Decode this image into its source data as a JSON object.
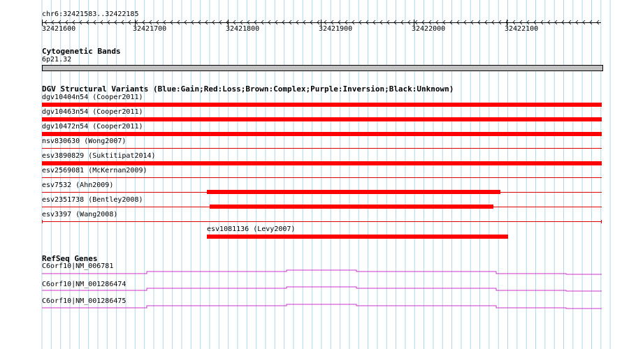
{
  "ruler": {
    "title": "chr6:32421583..32422185",
    "ticks": [
      "32421600",
      "32421700",
      "32421800",
      "32421900",
      "32422000",
      "32422100"
    ]
  },
  "cytoband": {
    "heading": "Cytogenetic Bands",
    "band_label": "6p21.32"
  },
  "dgv": {
    "heading": "DGV Structural Variants (Blue:Gain;Red:Loss;Brown:Complex;Purple:Inversion;Black:Unknown)",
    "variants": [
      "dgv10404n54 (Cooper2011)",
      "dgv10463n54 (Cooper2011)",
      "dgv10472n54 (Cooper2011)",
      "nsv830630 (Wong2007)",
      "esv3890829 (Suktitipat2014)",
      "esv2569081 (McKernan2009)",
      "esv7532 (Ahn2009)",
      "esv2351738 (Bentley2008)",
      "esv3397 (Wang2008)",
      "esv1081136 (Levy2007)"
    ]
  },
  "refseq": {
    "heading": "RefSeq Genes",
    "genes": [
      "C6orf10|NM_006781",
      "C6orf10|NM_001286474",
      "C6orf10|NM_001286475"
    ]
  },
  "colors": {
    "loss": "#ff0000",
    "gene": "#cc33cc",
    "grid": "#add8e6"
  }
}
